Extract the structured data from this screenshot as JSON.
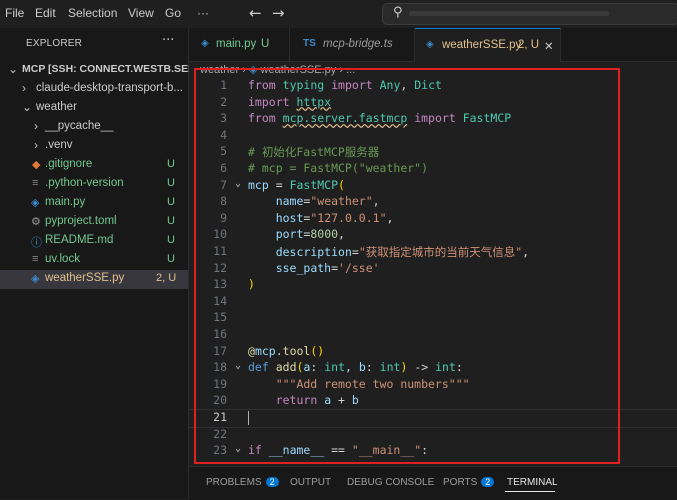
{
  "menu": {
    "file": "File",
    "edit": "Edit",
    "selection": "Selection",
    "view": "View",
    "go": "Go",
    "more": "···"
  },
  "explorer": {
    "title": "EXPLORER",
    "more": "···",
    "root_label": "MCP [SSH: CONNECT.WESTB.SEET...",
    "items": [
      {
        "label": "claude-desktop-transport-b...",
        "kind": "folder",
        "badge": ""
      },
      {
        "label": "weather",
        "kind": "folder-open",
        "badge": ""
      },
      {
        "label": "__pycache__",
        "kind": "folder",
        "badge": ""
      },
      {
        "label": ".venv",
        "kind": "folder",
        "badge": ""
      },
      {
        "label": ".gitignore",
        "kind": "file",
        "badge": "U"
      },
      {
        "label": ".python-version",
        "kind": "file",
        "badge": "U"
      },
      {
        "label": "main.py",
        "kind": "python",
        "badge": "U"
      },
      {
        "label": "pyproject.toml",
        "kind": "toml",
        "badge": "U"
      },
      {
        "label": "README.md",
        "kind": "info",
        "badge": "U"
      },
      {
        "label": "uv.lock",
        "kind": "file",
        "badge": "U"
      },
      {
        "label": "weatherSSE.py",
        "kind": "python",
        "badge": "2, U"
      }
    ]
  },
  "tabs": [
    {
      "label": "main.py",
      "badge": "U",
      "icon": "python-icon"
    },
    {
      "label": "mcp-bridge.ts",
      "badge": "",
      "icon": "ts-icon",
      "icon_text": "TS"
    },
    {
      "label": "weatherSSE.py",
      "badge": "2, U",
      "icon": "python-icon",
      "close": "✕"
    }
  ],
  "breadcrumb": {
    "folder": "weather",
    "file": "weatherSSE.py",
    "rest": "..."
  },
  "code": {
    "lines": [
      {
        "n": "1",
        "t": "from typing import Any, Dict"
      },
      {
        "n": "2",
        "t": "import httpx"
      },
      {
        "n": "3",
        "t": "from mcp.server.fastmcp import FastMCP"
      },
      {
        "n": "4",
        "t": ""
      },
      {
        "n": "5",
        "t": "# 初始化FastMCP服务器"
      },
      {
        "n": "6",
        "t": "# mcp = FastMCP(\"weather\")"
      },
      {
        "n": "7",
        "t": "mcp = FastMCP("
      },
      {
        "n": "8",
        "t": "    name=\"weather\","
      },
      {
        "n": "9",
        "t": "    host=\"127.0.0.1\","
      },
      {
        "n": "10",
        "t": "    port=8000,"
      },
      {
        "n": "11",
        "t": "    description=\"获取指定城市的当前天气信息\","
      },
      {
        "n": "12",
        "t": "    sse_path='/sse'"
      },
      {
        "n": "13",
        "t": ")"
      },
      {
        "n": "14",
        "t": ""
      },
      {
        "n": "15",
        "t": ""
      },
      {
        "n": "16",
        "t": ""
      },
      {
        "n": "17",
        "t": "@mcp.tool()"
      },
      {
        "n": "18",
        "t": "def add(a: int, b: int) -> int:"
      },
      {
        "n": "19",
        "t": "    \"\"\"Add remote two numbers\"\"\""
      },
      {
        "n": "20",
        "t": "    return a + b"
      },
      {
        "n": "21",
        "t": ""
      },
      {
        "n": "22",
        "t": ""
      },
      {
        "n": "23",
        "t": "if __name__ == \"__main__\":"
      }
    ]
  },
  "panel": {
    "problems": "PROBLEMS",
    "problems_count": "2",
    "output": "OUTPUT",
    "debug": "DEBUG CONSOLE",
    "ports": "PORTS",
    "ports_count": "2",
    "terminal": "TERMINAL"
  },
  "colors": {
    "accent": "#0078d4",
    "highlight": "#e02020",
    "untracked": "#73c991",
    "modified": "#e2c08d"
  }
}
